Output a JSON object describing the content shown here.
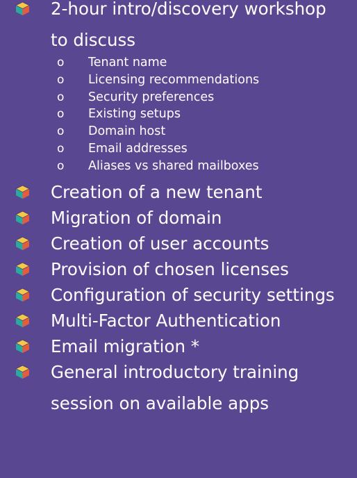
{
  "items": [
    {
      "line1": "2-hour intro/discovery workshop",
      "line2": "to discuss",
      "icon": "cube-bullet-icon",
      "subitems": [
        "Tenant name",
        "Licensing recommendations",
        "Security preferences",
        "Existing setups",
        "Domain host",
        "Email addresses",
        "Aliases vs shared mailboxes"
      ]
    },
    {
      "line1": "Creation of a new tenant",
      "icon": "cube-bullet-icon"
    },
    {
      "line1": "Migration of domain",
      "icon": "cube-bullet-icon"
    },
    {
      "line1": "Creation of user accounts",
      "icon": "cube-bullet-icon"
    },
    {
      "line1": "Provision of chosen licenses",
      "icon": "cube-bullet-icon"
    },
    {
      "line1": "Configuration of security settings",
      "icon": "cube-bullet-icon"
    },
    {
      "line1": "Multi-Factor Authentication",
      "icon": "cube-bullet-icon"
    },
    {
      "line1": "Email migration *",
      "icon": "cube-bullet-icon"
    },
    {
      "line1": "General introductory training",
      "line2": "session on available apps",
      "icon": "cube-bullet-icon"
    }
  ],
  "sub_bullet_glyph": "o",
  "colors": {
    "background": "#5a4791",
    "text": "#ffffff",
    "bullet_top": "#f2c84b",
    "bullet_left": "#2aa9a0",
    "bullet_right": "#e25d3f"
  }
}
